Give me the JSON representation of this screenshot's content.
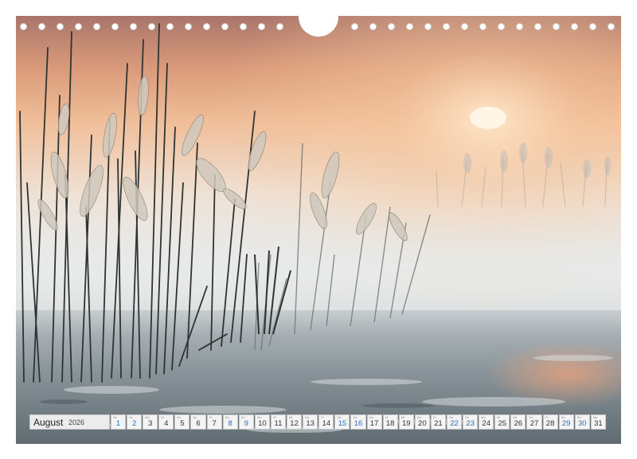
{
  "calendar": {
    "month": "August",
    "year": "2026",
    "days": [
      {
        "num": "1",
        "weekday": "Sa",
        "weekend": true
      },
      {
        "num": "2",
        "weekday": "So",
        "weekend": true
      },
      {
        "num": "3",
        "weekday": "Mo",
        "weekend": false
      },
      {
        "num": "4",
        "weekday": "Di",
        "weekend": false
      },
      {
        "num": "5",
        "weekday": "Mi",
        "weekend": false
      },
      {
        "num": "6",
        "weekday": "Do",
        "weekend": false
      },
      {
        "num": "7",
        "weekday": "Fr",
        "weekend": false
      },
      {
        "num": "8",
        "weekday": "Sa",
        "weekend": true
      },
      {
        "num": "9",
        "weekday": "So",
        "weekend": true
      },
      {
        "num": "10",
        "weekday": "Mo",
        "weekend": false
      },
      {
        "num": "11",
        "weekday": "Di",
        "weekend": false
      },
      {
        "num": "12",
        "weekday": "Mi",
        "weekend": false
      },
      {
        "num": "13",
        "weekday": "Do",
        "weekend": false
      },
      {
        "num": "14",
        "weekday": "Fr",
        "weekend": false
      },
      {
        "num": "15",
        "weekday": "Sa",
        "weekend": true
      },
      {
        "num": "16",
        "weekday": "So",
        "weekend": true
      },
      {
        "num": "17",
        "weekday": "Mo",
        "weekend": false
      },
      {
        "num": "18",
        "weekday": "Di",
        "weekend": false
      },
      {
        "num": "19",
        "weekday": "Mi",
        "weekend": false
      },
      {
        "num": "20",
        "weekday": "Do",
        "weekend": false
      },
      {
        "num": "21",
        "weekday": "Fr",
        "weekend": false
      },
      {
        "num": "22",
        "weekday": "Sa",
        "weekend": true
      },
      {
        "num": "23",
        "weekday": "So",
        "weekend": true
      },
      {
        "num": "24",
        "weekday": "Mo",
        "weekend": false
      },
      {
        "num": "25",
        "weekday": "Di",
        "weekend": false
      },
      {
        "num": "26",
        "weekday": "Mi",
        "weekend": false
      },
      {
        "num": "27",
        "weekday": "Do",
        "weekend": false
      },
      {
        "num": "28",
        "weekday": "Fr",
        "weekend": false
      },
      {
        "num": "29",
        "weekday": "Sa",
        "weekend": true
      },
      {
        "num": "30",
        "weekday": "So",
        "weekend": true
      },
      {
        "num": "31",
        "weekday": "Mo",
        "weekend": false
      }
    ]
  },
  "colors": {
    "weekend_number": "#2a6fc2",
    "sky_top": "#a9756a",
    "sky_glow": "#f0b48a",
    "fog": "#e4e6e4",
    "water": "#5f6b71"
  }
}
